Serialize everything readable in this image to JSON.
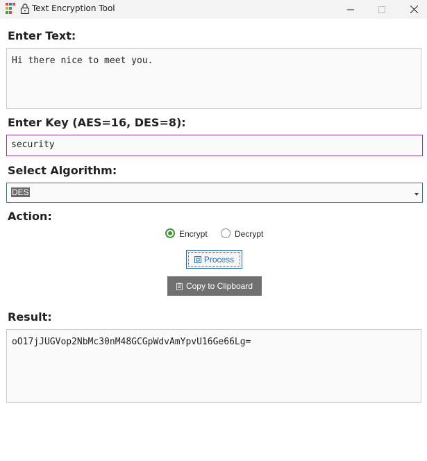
{
  "window": {
    "title": "Text Encryption Tool",
    "app_icon": "app-grid-icon",
    "lock_icon": "lock-icon"
  },
  "input": {
    "label": "Enter Text:",
    "value": "Hi there nice to meet you."
  },
  "key": {
    "label": "Enter Key (AES=16, DES=8):",
    "value": "security"
  },
  "algorithm": {
    "label": "Select Algorithm:",
    "selected": "DES"
  },
  "action": {
    "label": "Action:",
    "options": [
      "Encrypt",
      "Decrypt"
    ],
    "selected": "Encrypt"
  },
  "buttons": {
    "process_label": "Process",
    "copy_label": "Copy to Clipboard"
  },
  "result": {
    "label": "Result:",
    "value": "oO17jJUGVop2NbMc30nM48GCGpWdvAmYpvU16Ge66Lg="
  },
  "colors": {
    "accent_blue": "#1f6fb3",
    "key_border": "#8a3aa6",
    "radio_green": "#3c9a2f",
    "copy_button": "#707070"
  }
}
